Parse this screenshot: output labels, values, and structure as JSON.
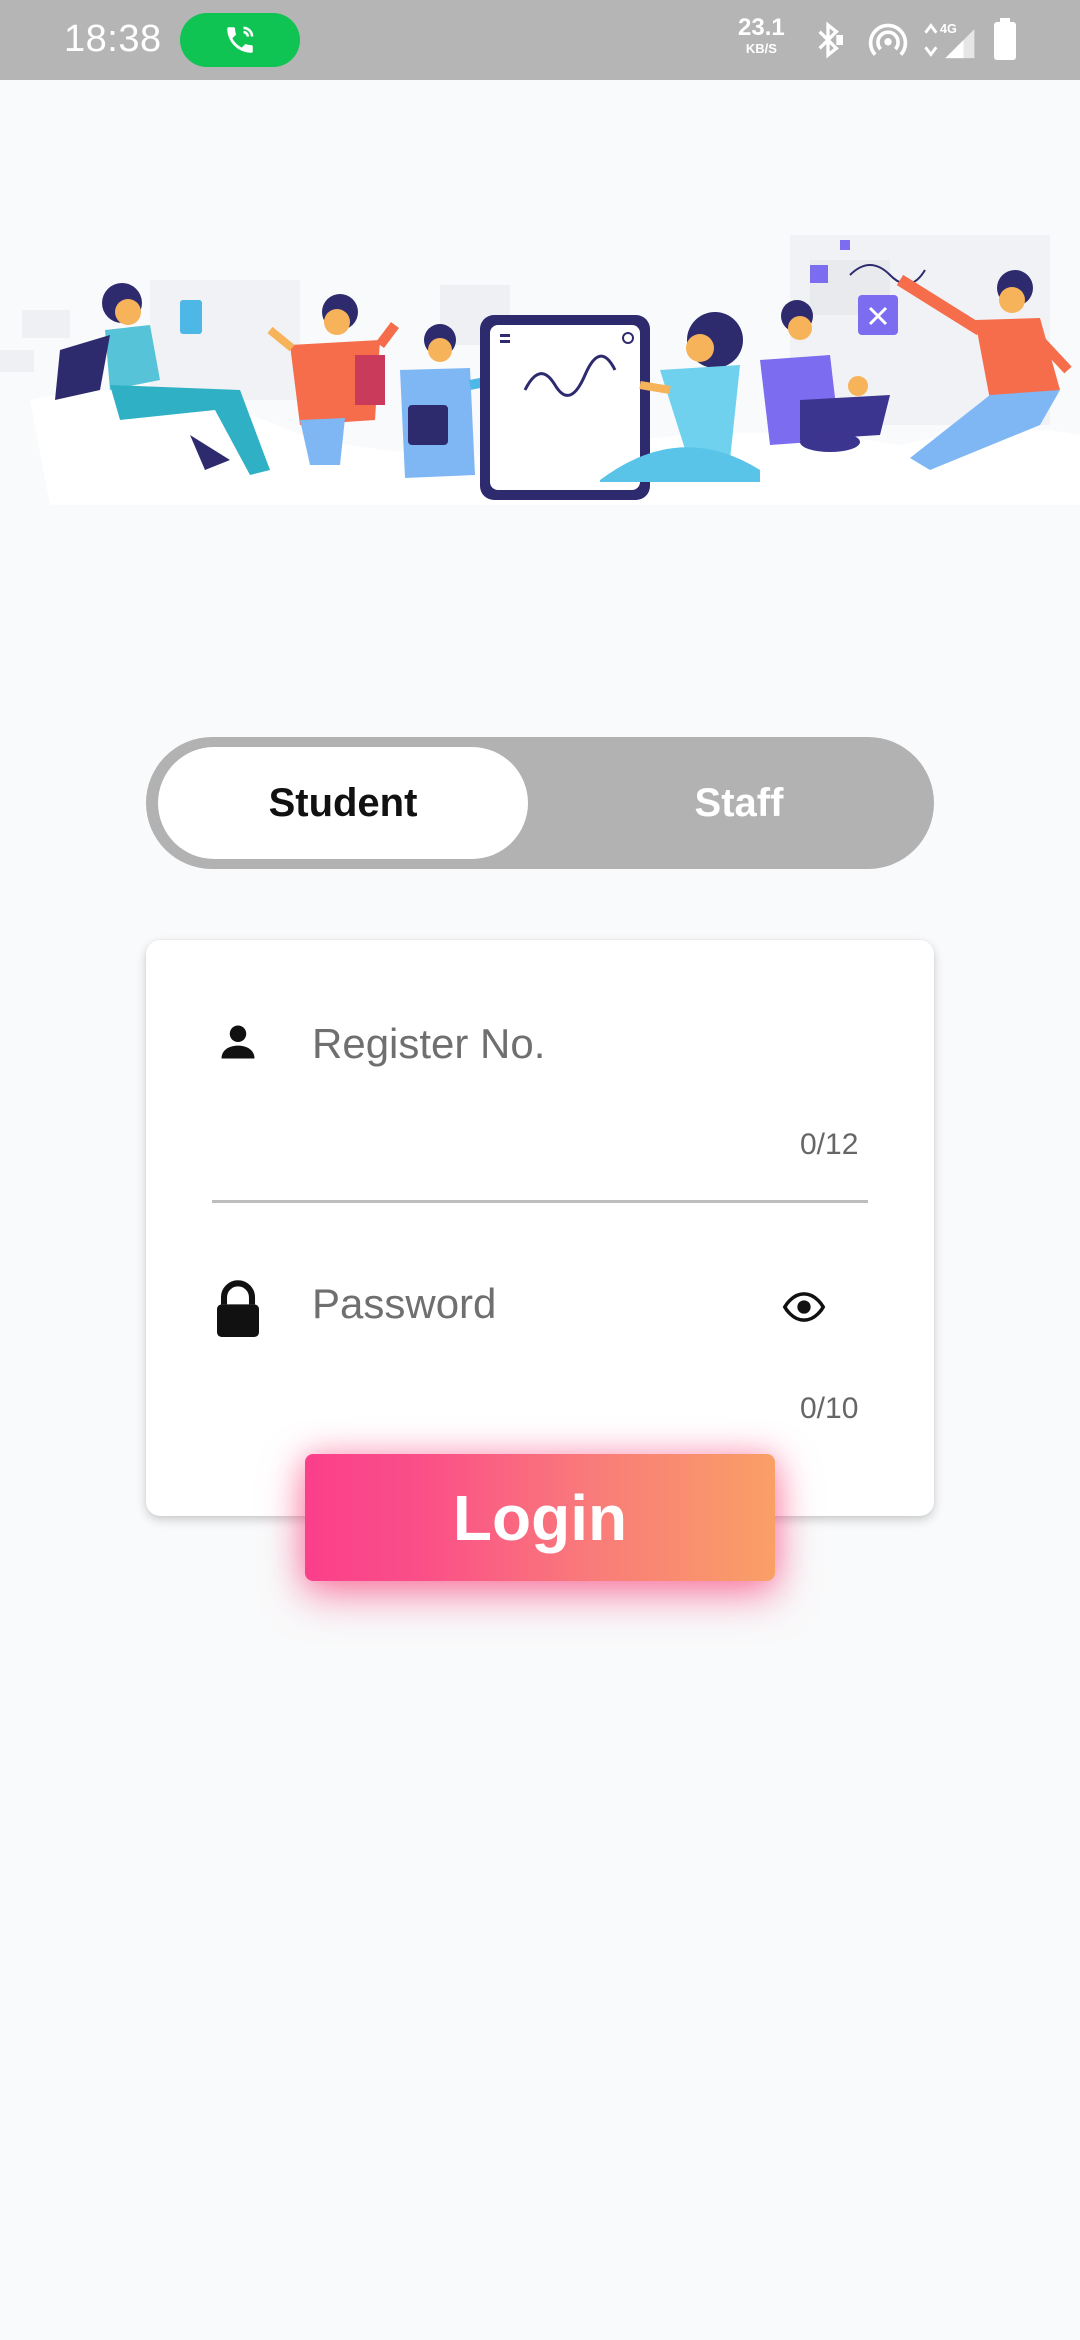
{
  "status_bar": {
    "time": "18:38",
    "net_speed_value": "23.1",
    "net_speed_unit": "KB/S",
    "network_type": "4G",
    "call_active_color": "#10c454",
    "icons": [
      "call-icon",
      "bluetooth-icon",
      "hotspot-icon",
      "signal-icon",
      "battery-icon"
    ]
  },
  "hero": {
    "illustration": "students-collaboration-illustration"
  },
  "toggle": {
    "options": [
      "Student",
      "Staff"
    ],
    "selected": "Student"
  },
  "form": {
    "register": {
      "placeholder": "Register No.",
      "value": "",
      "counter": "0/12",
      "icon": "person-icon"
    },
    "password": {
      "placeholder": "Password",
      "value": "",
      "counter": "0/10",
      "icon": "lock-icon",
      "visibility_icon": "eye-icon"
    }
  },
  "login": {
    "label": "Login",
    "gradient": [
      "#fb3f8b",
      "#f9a066"
    ]
  },
  "colors": {
    "background": "#f9fafb",
    "status_bar": "#b5b5b5",
    "toggle_track": "#b2b2b2"
  }
}
